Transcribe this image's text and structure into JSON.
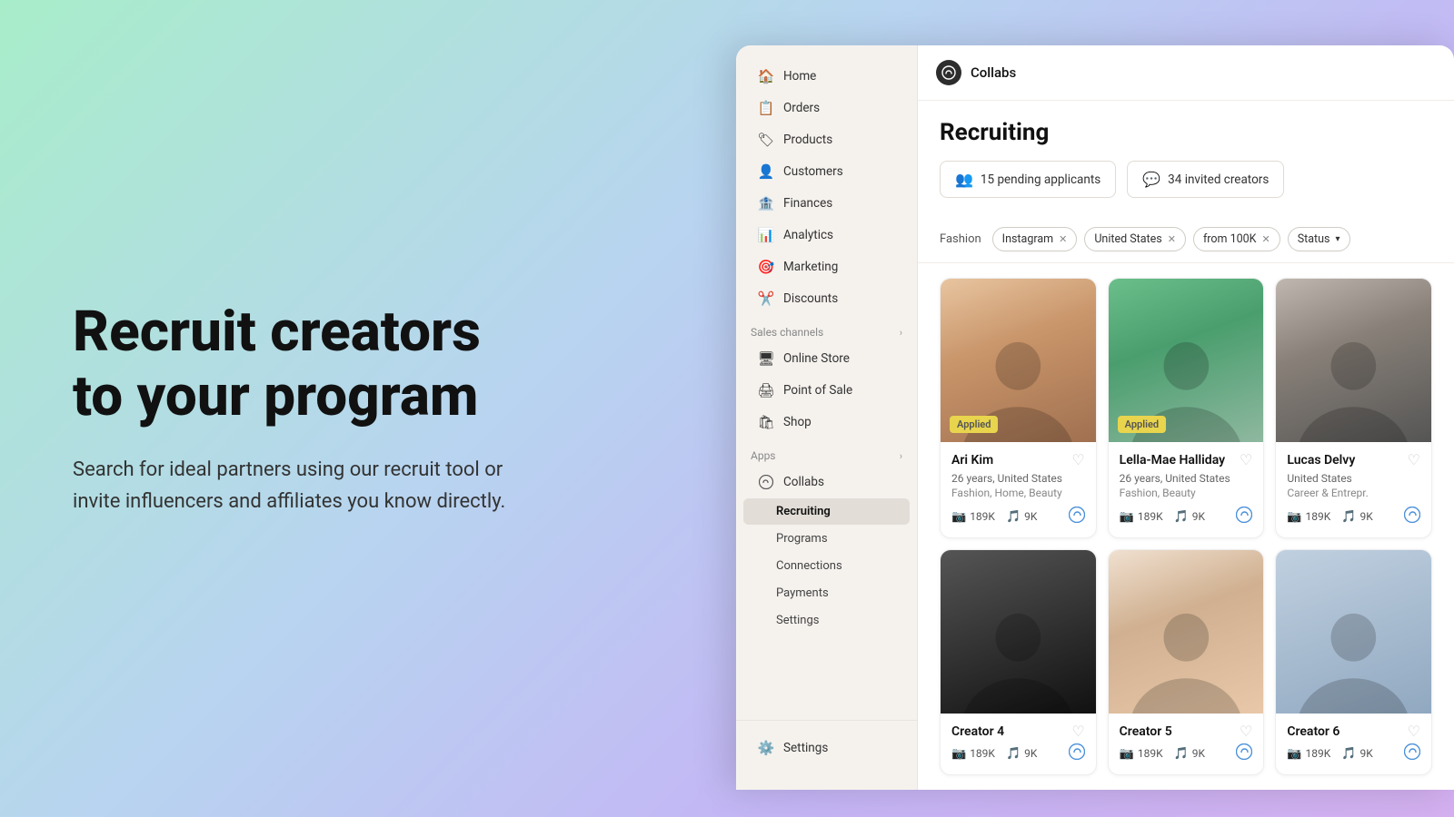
{
  "hero": {
    "title": "Recruit creators to your program",
    "subtitle": "Search for ideal partners using our recruit tool or invite influencers and affiliates you know directly."
  },
  "sidebar": {
    "items": [
      {
        "label": "Home",
        "icon": "🏠"
      },
      {
        "label": "Orders",
        "icon": "📋"
      },
      {
        "label": "Products",
        "icon": "🏷"
      },
      {
        "label": "Customers",
        "icon": "👤"
      },
      {
        "label": "Finances",
        "icon": "🏦"
      },
      {
        "label": "Analytics",
        "icon": "📊"
      },
      {
        "label": "Marketing",
        "icon": "🎯"
      },
      {
        "label": "Discounts",
        "icon": "🏷"
      }
    ],
    "sales_channels_label": "Sales channels",
    "sales_channels": [
      {
        "label": "Online Store",
        "icon": "🖥"
      },
      {
        "label": "Point of Sale",
        "icon": "🖨"
      },
      {
        "label": "Shop",
        "icon": "🛍"
      }
    ],
    "apps_label": "Apps",
    "collabs_label": "Collabs",
    "sub_items": [
      {
        "label": "Recruiting",
        "active": true
      },
      {
        "label": "Programs"
      },
      {
        "label": "Connections"
      },
      {
        "label": "Payments"
      },
      {
        "label": "Settings"
      }
    ],
    "settings_label": "Settings"
  },
  "topbar": {
    "title": "Collabs"
  },
  "page": {
    "title": "Recruiting",
    "pending_applicants": "15 pending applicants",
    "invited_creators": "34 invited creators",
    "filter_label": "Fashion",
    "filter_instagram": "Instagram",
    "filter_us": "United States",
    "filter_from100k": "from 100K",
    "filter_status": "Status"
  },
  "creators": [
    {
      "name": "Ari Kim",
      "age": "26 years",
      "country": "United States",
      "tags": "Fashion, Home, Beauty",
      "instagram_followers": "189K",
      "tiktok_followers": "9K",
      "applied": true,
      "liked": false,
      "photo_class": "photo-ari"
    },
    {
      "name": "Lella-Mae Halliday",
      "age": "26 years",
      "country": "United States",
      "tags": "Fashion, Beauty",
      "instagram_followers": "189K",
      "tiktok_followers": "9K",
      "applied": true,
      "liked": false,
      "photo_class": "photo-lella"
    },
    {
      "name": "Lucas Delvy",
      "age": "",
      "country": "United States",
      "tags": "Career & Entrepr.",
      "instagram_followers": "189K",
      "tiktok_followers": "9K",
      "applied": false,
      "liked": false,
      "photo_class": "photo-lucas"
    },
    {
      "name": "Creator 4",
      "age": "",
      "country": "",
      "tags": "",
      "instagram_followers": "189K",
      "tiktok_followers": "9K",
      "applied": false,
      "liked": false,
      "photo_class": "photo-row2-1"
    },
    {
      "name": "Creator 5",
      "age": "",
      "country": "",
      "tags": "",
      "instagram_followers": "189K",
      "tiktok_followers": "9K",
      "applied": false,
      "liked": false,
      "photo_class": "photo-row2-2"
    },
    {
      "name": "Creator 6",
      "age": "",
      "country": "",
      "tags": "",
      "instagram_followers": "189K",
      "tiktok_followers": "9K",
      "applied": false,
      "liked": false,
      "photo_class": "photo-row2-3"
    }
  ]
}
